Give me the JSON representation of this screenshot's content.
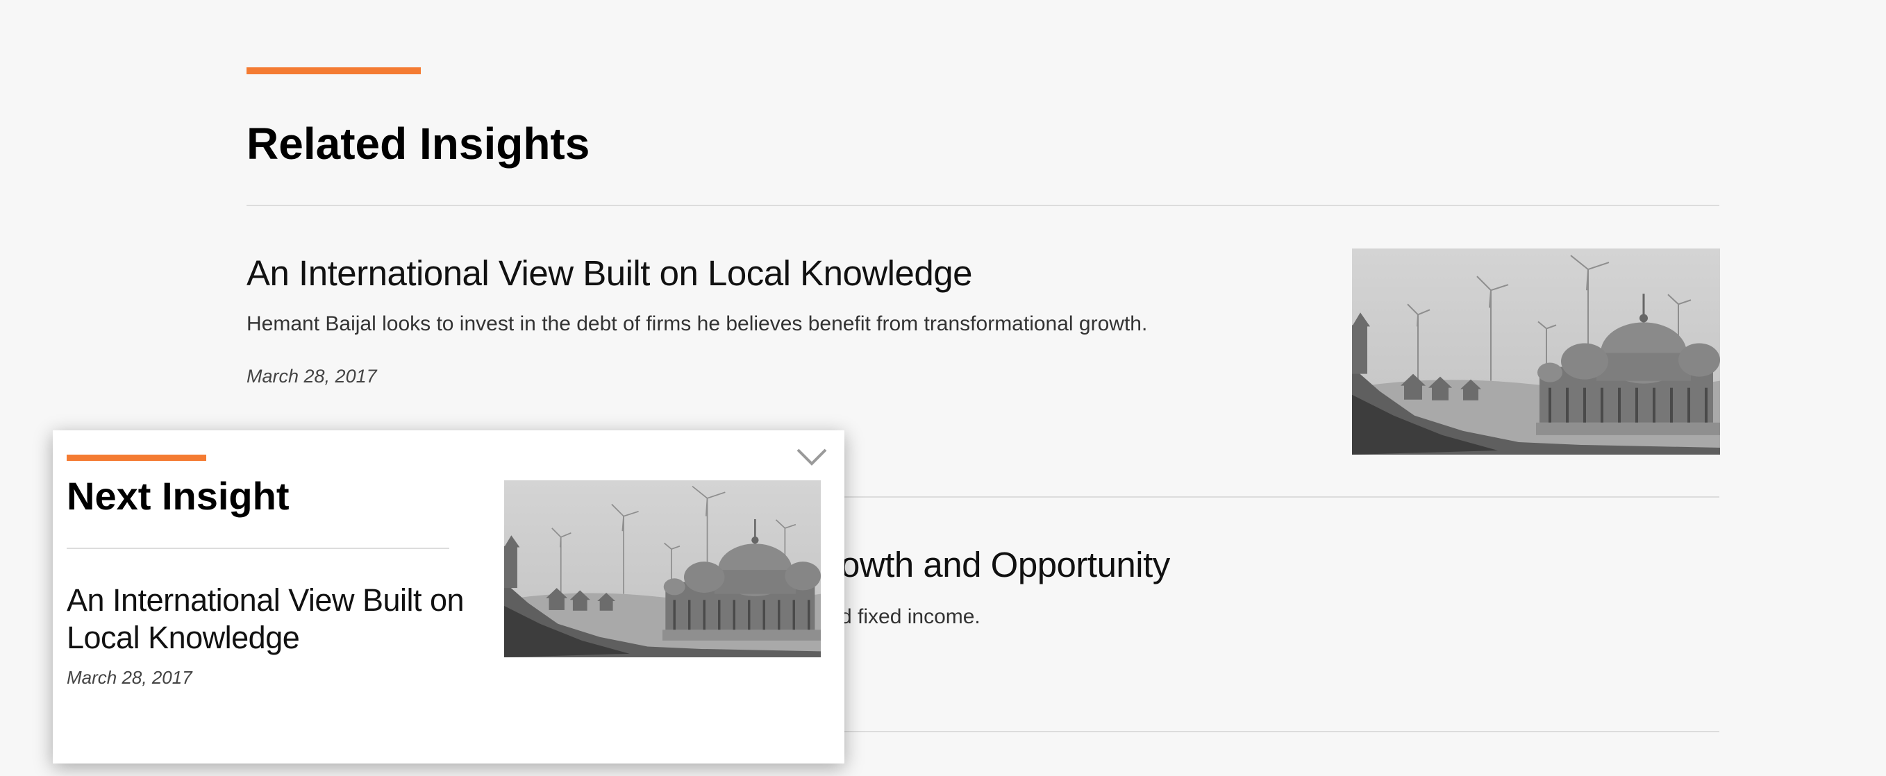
{
  "section": {
    "title": "Related Insights",
    "accent_color": "#f47b32"
  },
  "articles": [
    {
      "title": "An International View Built on Local Knowledge",
      "description": "Hemant Baijal looks to invest in the debt of firms he believes benefit from transformational growth.",
      "date": "March 28, 2017",
      "image": "grayscale-cenotaphs-wind-turbines"
    },
    {
      "title_visible": "owth and Opportunity",
      "description_visible": "d fixed income."
    }
  ],
  "next_insight": {
    "heading": "Next Insight",
    "title_line1": "An International View Built on",
    "title_line2": "Local Knowledge",
    "date": "March 28, 2017",
    "image": "grayscale-cenotaphs-wind-turbines",
    "collapse_icon": "chevron-down-icon"
  }
}
